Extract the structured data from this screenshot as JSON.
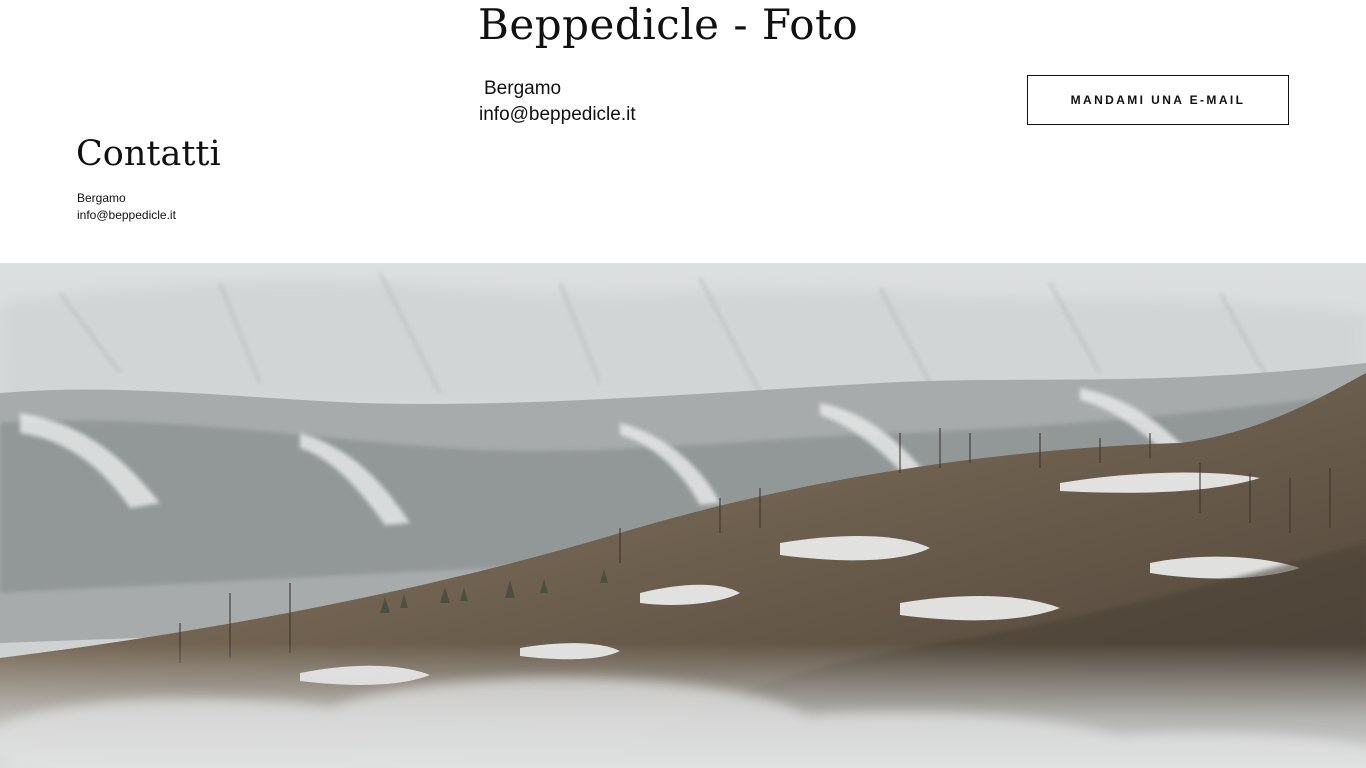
{
  "header": {
    "site_title": "Beppedicle - Foto",
    "city": "Bergamo",
    "email": "info@beppedicle.it",
    "email_button_label": "MANDAMI UNA E-MAIL"
  },
  "contact_section": {
    "heading": "Contatti",
    "city": "Bergamo",
    "email": "info@beppedicle.it"
  },
  "hero_image": {
    "subject": "snowy-mountain-landscape-with-mist"
  },
  "colors": {
    "text": "#111111",
    "background": "#ffffff",
    "button_border": "#111111"
  }
}
